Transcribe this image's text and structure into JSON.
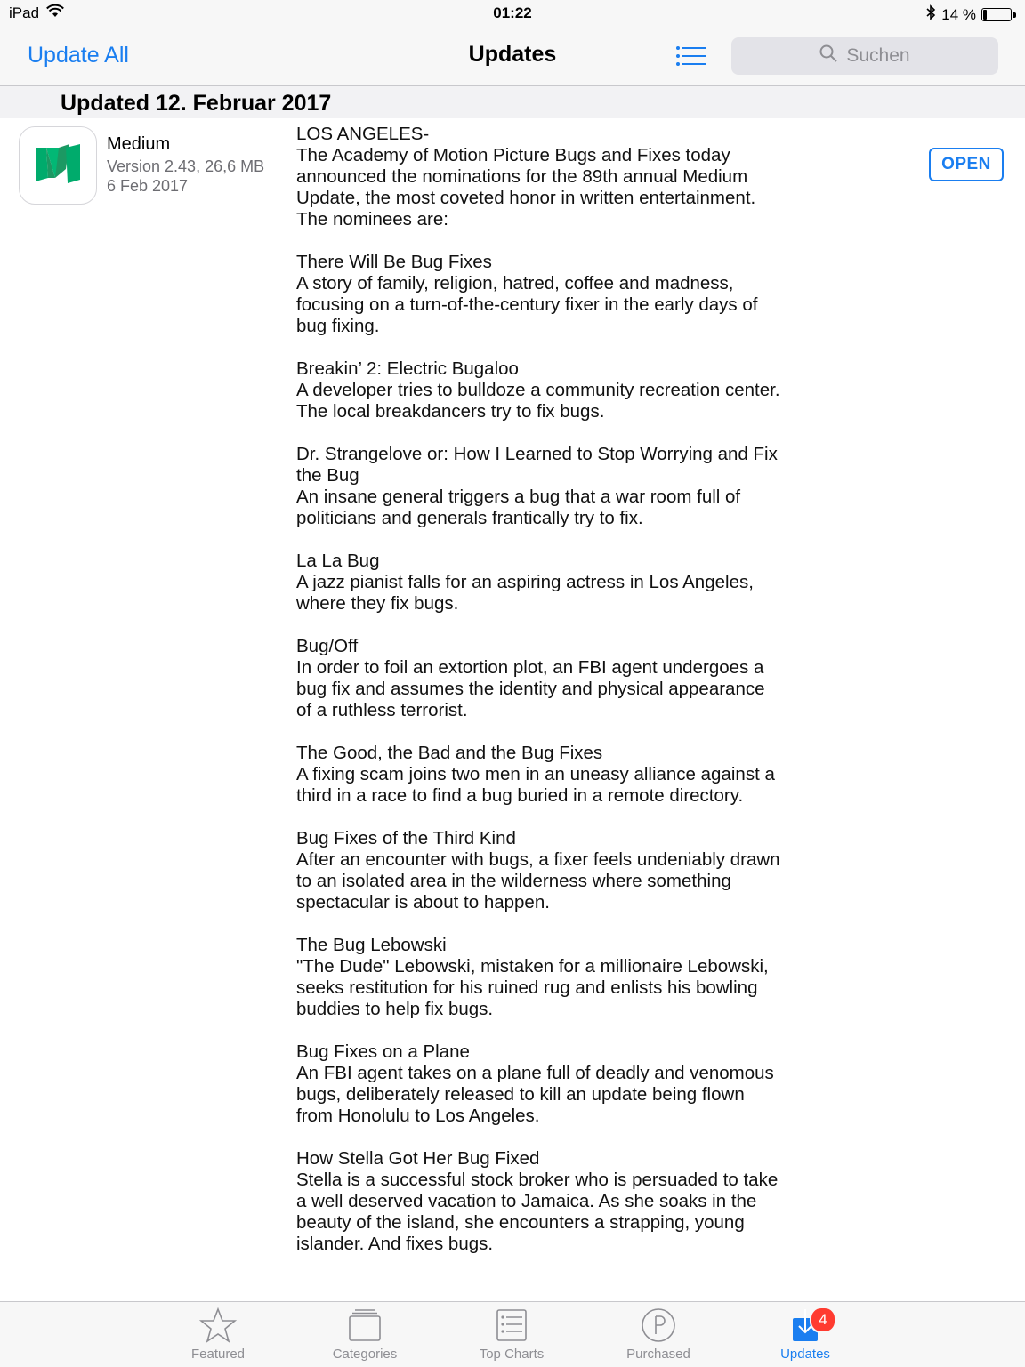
{
  "status_bar": {
    "device": "iPad",
    "time": "01:22",
    "battery": "14 %",
    "battery_level": 0.14
  },
  "nav": {
    "update_all": "Update All",
    "title": "Updates",
    "search_placeholder": "Suchen"
  },
  "section": {
    "title": "Updated 12. Februar 2017"
  },
  "app": {
    "name": "Medium",
    "version": "Version 2.43, 26,6 MB",
    "date": "6 Feb 2017",
    "open_label": "OPEN",
    "icon": "medium-logo-icon",
    "icon_color": "#00ab6c"
  },
  "release_notes": {
    "intro": [
      "LOS ANGELES-",
      "The Academy of Motion Picture Bugs and Fixes today",
      "announced the nominations for the 89th annual Medium",
      "Update, the most coveted honor in written entertainment.",
      "The nominees are:"
    ],
    "nominees": [
      {
        "title": "There Will Be Bug Fixes",
        "lines": [
          "A story of family, religion, hatred, coffee and madness,",
          "focusing on a turn-of-the-century fixer in the early days of",
          "bug fixing."
        ]
      },
      {
        "title": "Breakin’ 2: Electric Bugaloo",
        "lines": [
          "A developer tries to bulldoze a community recreation center.",
          "The local breakdancers try to fix bugs."
        ]
      },
      {
        "title": "Dr. Strangelove or: How I Learned to Stop Worrying and Fix",
        "title2": "the Bug",
        "lines": [
          "An insane general triggers a bug that a war room full of",
          "politicians and generals frantically try to fix."
        ]
      },
      {
        "title": "La La Bug",
        "lines": [
          "A jazz pianist falls for an aspiring actress in Los Angeles,",
          "where they fix bugs."
        ]
      },
      {
        "title": "Bug/Off",
        "lines": [
          "In order to foil an extortion plot, an FBI agent undergoes a",
          "bug fix and assumes the identity and physical appearance",
          "of a ruthless terrorist."
        ]
      },
      {
        "title": "The Good, the Bad and the Bug Fixes",
        "lines": [
          "A fixing scam joins two men in an uneasy alliance against a",
          "third in a race to find a bug buried in a remote directory."
        ]
      },
      {
        "title": "Bug Fixes of the Third Kind",
        "lines": [
          "After an encounter with bugs, a fixer feels undeniably drawn",
          "to an isolated area in the wilderness where something",
          "spectacular is about to happen."
        ]
      },
      {
        "title": "The Bug Lebowski",
        "lines": [
          "\"The Dude\" Lebowski, mistaken for a millionaire Lebowski,",
          "seeks restitution for his ruined rug and enlists his bowling",
          "buddies to help fix bugs."
        ]
      },
      {
        "title": "Bug Fixes on a Plane",
        "lines": [
          "An FBI agent takes on a plane full of deadly and venomous",
          "bugs, deliberately released to kill an update being flown",
          "from Honolulu to Los Angeles."
        ]
      },
      {
        "title": "How Stella Got Her Bug Fixed",
        "lines": [
          "Stella is a successful stock broker who is persuaded to take",
          "a well deserved vacation to Jamaica. As she soaks in the",
          "beauty of the island, she encounters a strapping, young",
          "islander. And fixes bugs."
        ]
      }
    ]
  },
  "tab_bar": {
    "tabs": [
      {
        "label": "Featured",
        "icon": "star-icon"
      },
      {
        "label": "Categories",
        "icon": "categories-icon"
      },
      {
        "label": "Top Charts",
        "icon": "list-icon"
      },
      {
        "label": "Purchased",
        "icon": "purchased-icon"
      },
      {
        "label": "Updates",
        "icon": "updates-icon",
        "badge": "4",
        "active": true
      }
    ]
  },
  "colors": {
    "accent": "#1a7ef0",
    "badge": "#ff3b30"
  }
}
